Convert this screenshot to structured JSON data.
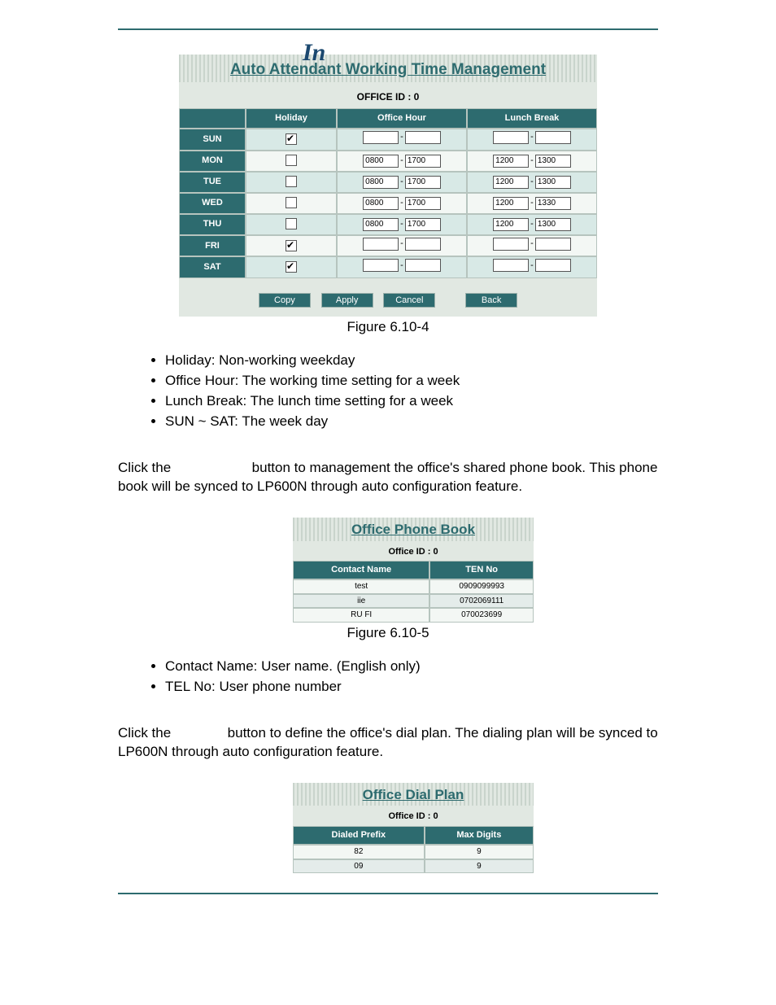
{
  "header": {
    "logo_text": "In"
  },
  "panel1": {
    "title": "Auto Attendant Working Time Management",
    "office_id_label": "OFFICE ID : 0",
    "headers": {
      "day_blank": "",
      "holiday": "Holiday",
      "office_hour": "Office Hour",
      "lunch": "Lunch Break"
    },
    "rows": [
      {
        "day": "SUN",
        "holiday": true,
        "oh_from": "",
        "oh_to": "",
        "lb_from": "",
        "lb_to": ""
      },
      {
        "day": "MON",
        "holiday": false,
        "oh_from": "0800",
        "oh_to": "1700",
        "lb_from": "1200",
        "lb_to": "1300"
      },
      {
        "day": "TUE",
        "holiday": false,
        "oh_from": "0800",
        "oh_to": "1700",
        "lb_from": "1200",
        "lb_to": "1300"
      },
      {
        "day": "WED",
        "holiday": false,
        "oh_from": "0800",
        "oh_to": "1700",
        "lb_from": "1200",
        "lb_to": "1330"
      },
      {
        "day": "THU",
        "holiday": false,
        "oh_from": "0800",
        "oh_to": "1700",
        "lb_from": "1200",
        "lb_to": "1300"
      },
      {
        "day": "FRI",
        "holiday": true,
        "oh_from": "",
        "oh_to": "",
        "lb_from": "",
        "lb_to": ""
      },
      {
        "day": "SAT",
        "holiday": true,
        "oh_from": "",
        "oh_to": "",
        "lb_from": "",
        "lb_to": ""
      }
    ],
    "buttons": {
      "copy": "Copy",
      "apply": "Apply",
      "cancel": "Cancel",
      "back": "Back"
    }
  },
  "figcap1": "Figure 6.10-4",
  "bullets1": [
    "Holiday: Non-working weekday",
    "Office Hour: The working time setting for a week",
    "Lunch Break: The lunch time setting for a week",
    "SUN ~ SAT: The week day"
  ],
  "para1_a": "Click the ",
  "para1_b": " button to management the office's shared phone book. This phone book will be synced to LP600N through auto configuration feature.",
  "panel2": {
    "title": "Office Phone Book",
    "office_id_label": "Office ID : 0",
    "headers": {
      "name": "Contact Name",
      "tel": "TEN No"
    },
    "rows": [
      {
        "name": "test",
        "tel": "0909099993"
      },
      {
        "name": "iie",
        "tel": "0702069111"
      },
      {
        "name": "RU FI",
        "tel": "070023699"
      }
    ]
  },
  "figcap2": "Figure 6.10-5",
  "bullets2": [
    "Contact Name: User name. (English only)",
    "TEL No: User phone number"
  ],
  "para2_a": "Click the ",
  "para2_b": " button to define the office's dial plan. The dialing plan will be synced to LP600N through auto configuration feature.",
  "panel3": {
    "title": "Office Dial Plan",
    "office_id_label": "Office ID : 0",
    "headers": {
      "prefix": "Dialed Prefix",
      "max": "Max Digits"
    },
    "rows": [
      {
        "prefix": "82",
        "max": "9"
      },
      {
        "prefix": "09",
        "max": "9"
      }
    ]
  }
}
